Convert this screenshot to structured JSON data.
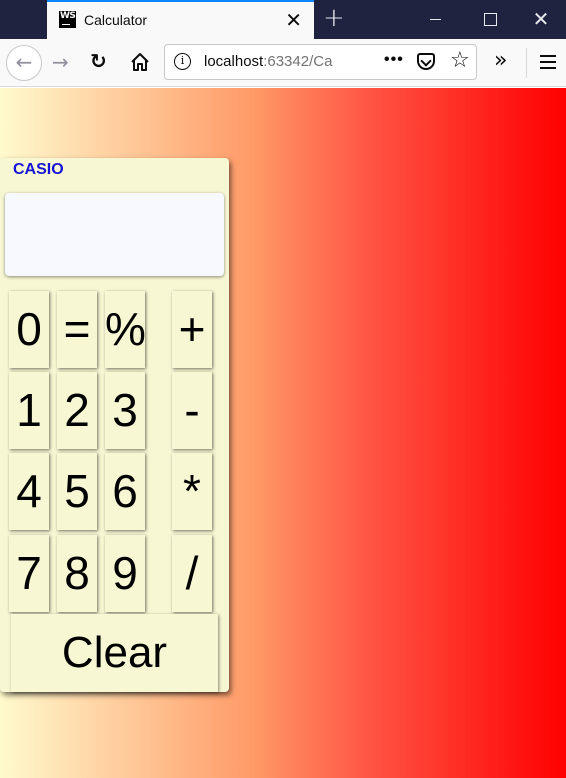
{
  "browser": {
    "tab_title": "Calculator",
    "tab_favicon_text": "WS",
    "url_host": "localhost",
    "url_rest": ":63342/Ca",
    "url_more": "•••"
  },
  "calculator": {
    "brand": "CASIO",
    "display_value": "",
    "keys": [
      [
        "0",
        "=",
        "%",
        "+"
      ],
      [
        "1",
        "2",
        "3",
        "-"
      ],
      [
        "4",
        "5",
        "6",
        "*"
      ],
      [
        "7",
        "8",
        "9",
        "/"
      ]
    ],
    "clear_label": "Clear"
  },
  "colors": {
    "gradient_start": "#fffacd",
    "gradient_end": "#ff0000",
    "calculator_body": "#f7f7d4",
    "brand_text": "#1515d6"
  }
}
